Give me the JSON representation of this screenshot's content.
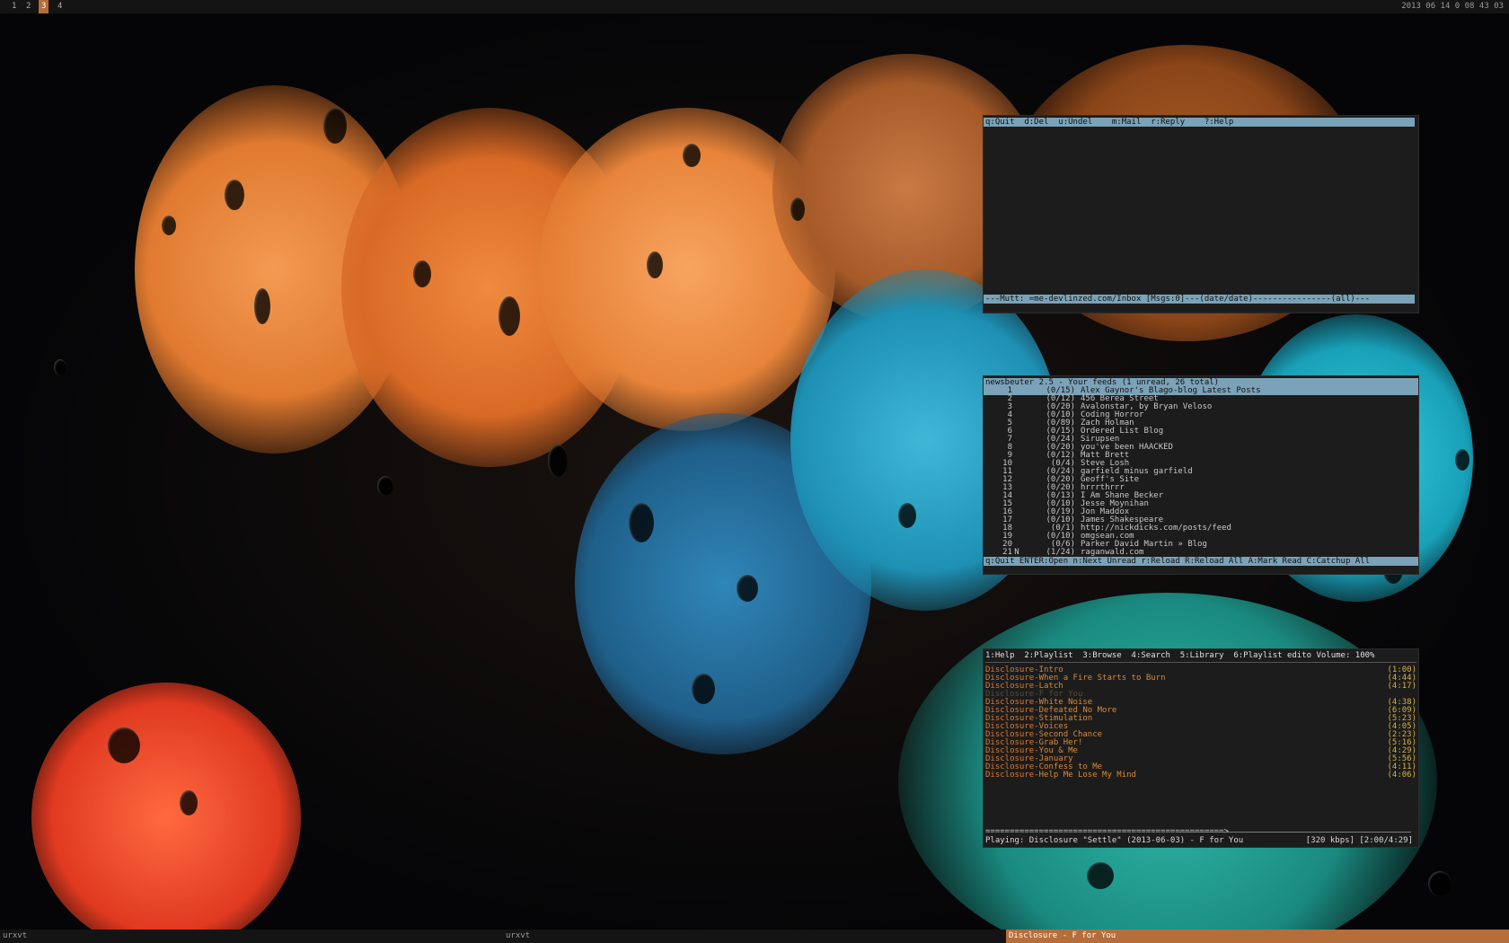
{
  "topbar": {
    "workspaces": [
      {
        "label": "1",
        "active": false
      },
      {
        "label": "2",
        "active": false
      },
      {
        "label": "3",
        "active": true
      },
      {
        "label": "4",
        "active": false
      }
    ],
    "clock": "2013 06 14 0 08 43 03"
  },
  "bottombar": {
    "tasks": [
      {
        "label": "urxvt",
        "active": false
      },
      {
        "label": "urxvt",
        "active": false
      },
      {
        "label": "Disclosure - F for You",
        "active": true
      }
    ]
  },
  "mutt": {
    "help_bar": "q:Quit  d:Del  u:Undel    m:Mail  r:Reply    ?:Help",
    "status_bar": "---Mutt: =me-devlinzed.com/Inbox [Msgs:0]---(date/date)----------------(all)---"
  },
  "newsbeuter": {
    "title_bar": "newsbeuter 2.5 - Your feeds (1 unread, 26 total)",
    "feeds": [
      {
        "num": "1",
        "flag": "",
        "count": "(0/15)",
        "title": "Alex Gaynor's Blago-blog Latest Posts"
      },
      {
        "num": "2",
        "flag": "",
        "count": "(0/12)",
        "title": "456 Berea Street"
      },
      {
        "num": "3",
        "flag": "",
        "count": "(0/20)",
        "title": "Avalonstar, by Bryan Veloso"
      },
      {
        "num": "4",
        "flag": "",
        "count": "(0/10)",
        "title": "Coding Horror"
      },
      {
        "num": "5",
        "flag": "",
        "count": "(0/89)",
        "title": "Zach Holman"
      },
      {
        "num": "6",
        "flag": "",
        "count": "(0/15)",
        "title": "Ordered List Blog"
      },
      {
        "num": "7",
        "flag": "",
        "count": "(0/24)",
        "title": "Sirupsen"
      },
      {
        "num": "8",
        "flag": "",
        "count": "(0/20)",
        "title": "you've been HAACKED"
      },
      {
        "num": "9",
        "flag": "",
        "count": "(0/12)",
        "title": "Matt Brett"
      },
      {
        "num": "10",
        "flag": "",
        "count": "(0/4)",
        "title": "Steve Losh"
      },
      {
        "num": "11",
        "flag": "",
        "count": "(0/24)",
        "title": "garfield minus garfield"
      },
      {
        "num": "12",
        "flag": "",
        "count": "(0/20)",
        "title": "Geoff's Site"
      },
      {
        "num": "13",
        "flag": "",
        "count": "(0/20)",
        "title": "hrrrthrrr"
      },
      {
        "num": "14",
        "flag": "",
        "count": "(0/13)",
        "title": "I Am Shane Becker"
      },
      {
        "num": "15",
        "flag": "",
        "count": "(0/10)",
        "title": "Jesse Moynihan"
      },
      {
        "num": "16",
        "flag": "",
        "count": "(0/19)",
        "title": "Jon Maddox"
      },
      {
        "num": "17",
        "flag": "",
        "count": "(0/10)",
        "title": "James Shakespeare"
      },
      {
        "num": "18",
        "flag": "",
        "count": "(0/1)",
        "title": "http://nickdicks.com/posts/feed"
      },
      {
        "num": "19",
        "flag": "",
        "count": "(0/10)",
        "title": "omgsean.com"
      },
      {
        "num": "20",
        "flag": "",
        "count": "(0/6)",
        "title": "Parker David Martin » Blog"
      },
      {
        "num": "21",
        "flag": "N",
        "count": "(1/24)",
        "title": "raganwald.com"
      }
    ],
    "help_bar": "q:Quit ENTER:Open n:Next Unread r:Reload R:Reload All A:Mark Read C:Catchup All"
  },
  "ncmpcpp": {
    "header": "1:Help  2:Playlist  3:Browse  4:Search  5:Library  6:Playlist edito Volume: 100%",
    "tracks": [
      {
        "artist": "Disclosure",
        "title": "Intro",
        "duration": "(1:00)",
        "playing": false
      },
      {
        "artist": "Disclosure",
        "title": "When a Fire Starts to Burn",
        "duration": "(4:44)",
        "playing": false
      },
      {
        "artist": "Disclosure",
        "title": "Latch",
        "duration": "(4:17)",
        "playing": false
      },
      {
        "artist": "Disclosure",
        "title": "F for You",
        "duration": "",
        "playing": true
      },
      {
        "artist": "Disclosure",
        "title": "White Noise",
        "duration": "(4:38)",
        "playing": false
      },
      {
        "artist": "Disclosure",
        "title": "Defeated No More",
        "duration": "(6:09)",
        "playing": false
      },
      {
        "artist": "Disclosure",
        "title": "Stimulation",
        "duration": "(5:23)",
        "playing": false
      },
      {
        "artist": "Disclosure",
        "title": "Voices",
        "duration": "(4:05)",
        "playing": false
      },
      {
        "artist": "Disclosure",
        "title": "Second Chance",
        "duration": "(2:23)",
        "playing": false
      },
      {
        "artist": "Disclosure",
        "title": "Grab Her!",
        "duration": "(5:16)",
        "playing": false
      },
      {
        "artist": "Disclosure",
        "title": "You & Me",
        "duration": "(4:29)",
        "playing": false
      },
      {
        "artist": "Disclosure",
        "title": "January",
        "duration": "(5:56)",
        "playing": false
      },
      {
        "artist": "Disclosure",
        "title": "Confess to Me",
        "duration": "(4:11)",
        "playing": false
      },
      {
        "artist": "Disclosure",
        "title": "Help Me Lose My Mind",
        "duration": "(4:06)",
        "playing": false
      }
    ],
    "progress_bar": "=================================================>",
    "now_playing": "Playing: Disclosure \"Settle\" (2013-06-03) - F for You",
    "bitrate_time": "[320 kbps] [2:00/4:29]"
  },
  "colors": {
    "accent": "#b56d3a",
    "bar": "#7aa2b8",
    "terminal_bg": "#1c1c1c",
    "track_artist": "#d97b34",
    "track_duration": "#d8b040"
  }
}
